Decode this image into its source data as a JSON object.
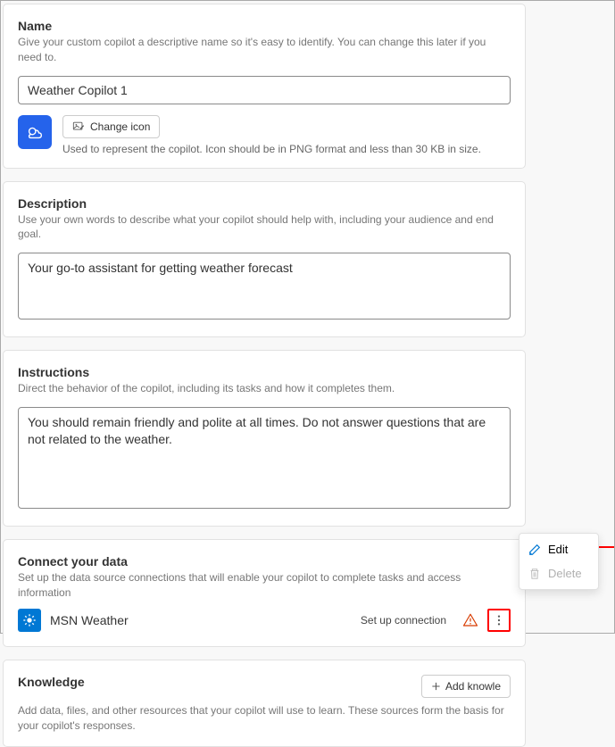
{
  "nameSection": {
    "title": "Name",
    "desc": "Give your custom copilot a descriptive name so it's easy to identify. You can change this later if you need to.",
    "value": "Weather Copilot 1",
    "changeIconLabel": "Change icon",
    "iconHelp": "Used to represent the copilot. Icon should be in PNG format and less than 30 KB in size."
  },
  "descriptionSection": {
    "title": "Description",
    "desc": "Use your own words to describe what your copilot should help with, including your audience and end goal.",
    "value": "Your go-to assistant for getting weather forecast"
  },
  "instructionsSection": {
    "title": "Instructions",
    "desc": "Direct the behavior of the copilot, including its tasks and how it completes them.",
    "value": "You should remain friendly and polite at all times. Do not answer questions that are not related to the weather."
  },
  "connectSection": {
    "title": "Connect your data",
    "desc": "Set up the data source connections that will enable your copilot to complete tasks and access information",
    "connectorName": "MSN Weather",
    "setupText": "Set up connection"
  },
  "knowledgeSection": {
    "title": "Knowledge",
    "addLabel": "Add knowle",
    "desc": "Add data, files, and other resources that your copilot will use to learn. These sources form the basis for your copilot's responses."
  },
  "popup": {
    "edit": "Edit",
    "delete": "Delete"
  }
}
